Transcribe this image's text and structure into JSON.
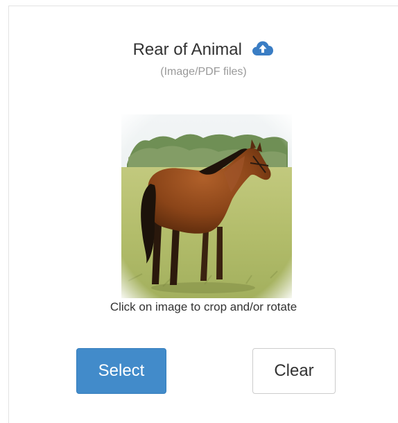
{
  "upload": {
    "title": "Rear of Animal",
    "upload_icon": "cloud-upload-icon",
    "subtitle": "(Image/PDF files)",
    "preview_image": "horse-rear-photo",
    "hint": "Click on image to crop and/or rotate"
  },
  "actions": {
    "select_label": "Select",
    "clear_label": "Clear"
  },
  "colors": {
    "select_bg": "#428bca",
    "upload_icon": "#3a7dc4",
    "subtitle_text": "#999999"
  }
}
